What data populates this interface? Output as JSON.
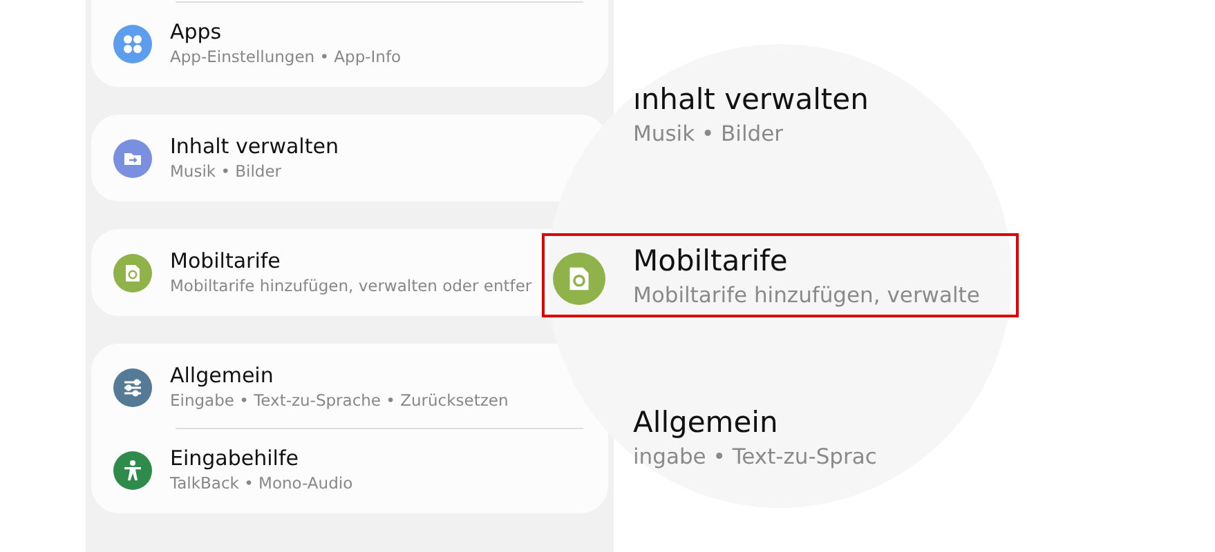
{
  "cards": [
    {
      "items": [
        {
          "title": "Apps",
          "subtitle": "App-Einstellungen • App-Info",
          "kind": "apps",
          "color": "#5c9ded"
        }
      ]
    },
    {
      "items": [
        {
          "title": "Inhalt verwalten",
          "subtitle": "Musik • Bilder",
          "kind": "folder",
          "color": "#7b8fe0"
        }
      ]
    },
    {
      "items": [
        {
          "title": "Mobiltarife",
          "subtitle": "Mobiltarife hinzufügen, verwalten oder entfer",
          "kind": "sim",
          "color": "#8fb34a"
        }
      ]
    },
    {
      "items": [
        {
          "title": "Allgemein",
          "subtitle": "Eingabe • Text-zu-Sprache • Zurücksetzen",
          "kind": "sliders",
          "color": "#547a96"
        },
        {
          "title": "Eingabehilfe",
          "subtitle": "TalkBack • Mono-Audio",
          "kind": "accessibility",
          "color": "#2e8b4c"
        }
      ]
    }
  ],
  "magnifier": {
    "items": [
      {
        "title": "ınhalt verwalten",
        "subtitle": "Musik • Bilder",
        "highlighted": false
      },
      {
        "title": "Mobiltarife",
        "subtitle": "Mobiltarife hinzufügen, verwalte",
        "kind": "sim",
        "color": "#8fb34a",
        "highlighted": true
      },
      {
        "title": "Allgemein",
        "subtitle": "ingabe • Text-zu-Sprac",
        "highlighted": false
      }
    ]
  }
}
